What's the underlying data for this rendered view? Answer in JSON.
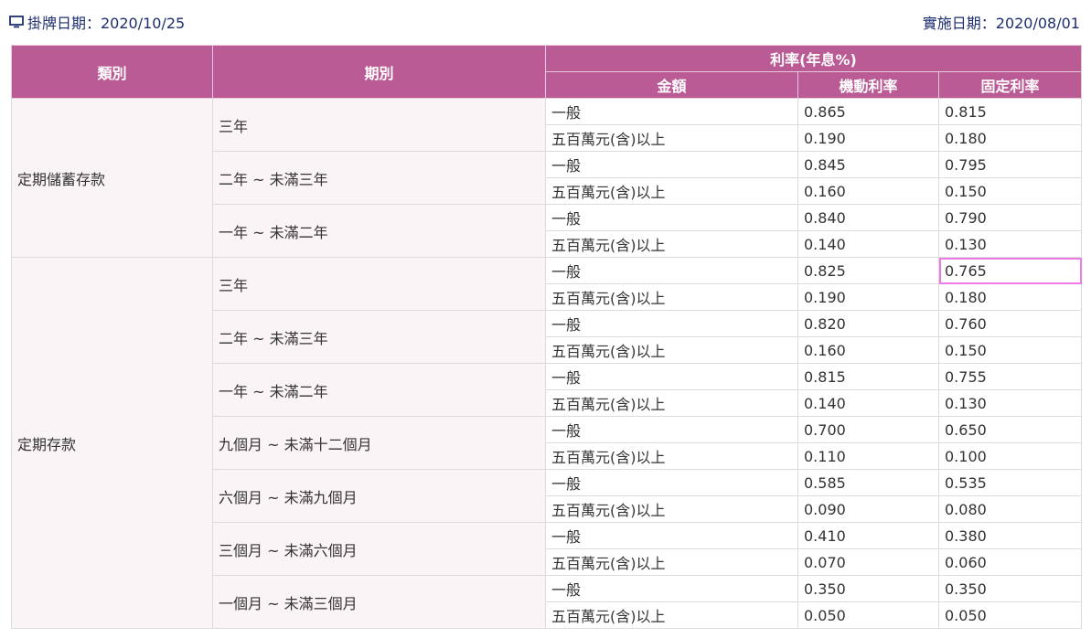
{
  "header": {
    "post_date": "掛牌日期：2020/10/25",
    "impl_date": "實施日期：2020/08/01"
  },
  "table": {
    "head": {
      "category": "類別",
      "period": "期別",
      "rate_group": "利率(年息%)",
      "amount": "金額",
      "floating": "機動利率",
      "fixed": "固定利率"
    },
    "groups": [
      {
        "category": "定期儲蓄存款",
        "periods": [
          {
            "label": "三年",
            "rows": [
              {
                "amount": "一般",
                "floating": "0.865",
                "fixed": "0.815"
              },
              {
                "amount": "五百萬元(含)以上",
                "floating": "0.190",
                "fixed": "0.180"
              }
            ]
          },
          {
            "label": "二年 ~ 未滿三年",
            "rows": [
              {
                "amount": "一般",
                "floating": "0.845",
                "fixed": "0.795"
              },
              {
                "amount": "五百萬元(含)以上",
                "floating": "0.160",
                "fixed": "0.150"
              }
            ]
          },
          {
            "label": "一年 ~ 未滿二年",
            "rows": [
              {
                "amount": "一般",
                "floating": "0.840",
                "fixed": "0.790"
              },
              {
                "amount": "五百萬元(含)以上",
                "floating": "0.140",
                "fixed": "0.130"
              }
            ]
          }
        ]
      },
      {
        "category": "定期存款",
        "periods": [
          {
            "label": "三年",
            "rows": [
              {
                "amount": "一般",
                "floating": "0.825",
                "fixed": "0.765"
              },
              {
                "amount": "五百萬元(含)以上",
                "floating": "0.190",
                "fixed": "0.180"
              }
            ]
          },
          {
            "label": "二年 ~ 未滿三年",
            "rows": [
              {
                "amount": "一般",
                "floating": "0.820",
                "fixed": "0.760"
              },
              {
                "amount": "五百萬元(含)以上",
                "floating": "0.160",
                "fixed": "0.150"
              }
            ]
          },
          {
            "label": "一年 ~ 未滿二年",
            "rows": [
              {
                "amount": "一般",
                "floating": "0.815",
                "fixed": "0.755"
              },
              {
                "amount": "五百萬元(含)以上",
                "floating": "0.140",
                "fixed": "0.130"
              }
            ]
          },
          {
            "label": "九個月 ~ 未滿十二個月",
            "rows": [
              {
                "amount": "一般",
                "floating": "0.700",
                "fixed": "0.650"
              },
              {
                "amount": "五百萬元(含)以上",
                "floating": "0.110",
                "fixed": "0.100"
              }
            ]
          },
          {
            "label": "六個月 ~ 未滿九個月",
            "rows": [
              {
                "amount": "一般",
                "floating": "0.585",
                "fixed": "0.535"
              },
              {
                "amount": "五百萬元(含)以上",
                "floating": "0.090",
                "fixed": "0.080"
              }
            ]
          },
          {
            "label": "三個月 ~ 未滿六個月",
            "rows": [
              {
                "amount": "一般",
                "floating": "0.410",
                "fixed": "0.380"
              },
              {
                "amount": "五百萬元(含)以上",
                "floating": "0.070",
                "fixed": "0.060"
              }
            ]
          },
          {
            "label": "一個月 ~ 未滿三個月",
            "rows": [
              {
                "amount": "一般",
                "floating": "0.350",
                "fixed": "0.350"
              },
              {
                "amount": "五百萬元(含)以上",
                "floating": "0.050",
                "fixed": "0.050"
              }
            ]
          }
        ]
      }
    ],
    "highlight": {
      "group": 1,
      "period": 0,
      "row": 0,
      "column": "fixed"
    }
  },
  "colors": {
    "header_bg": "#bb5b95",
    "header_text": "#ffffff",
    "label_cell_bg": "#fbf4f7",
    "date_text": "#1d2f6e",
    "highlight_outline": "#ee7be3"
  },
  "icons": {
    "post_date": "monitor-icon"
  }
}
